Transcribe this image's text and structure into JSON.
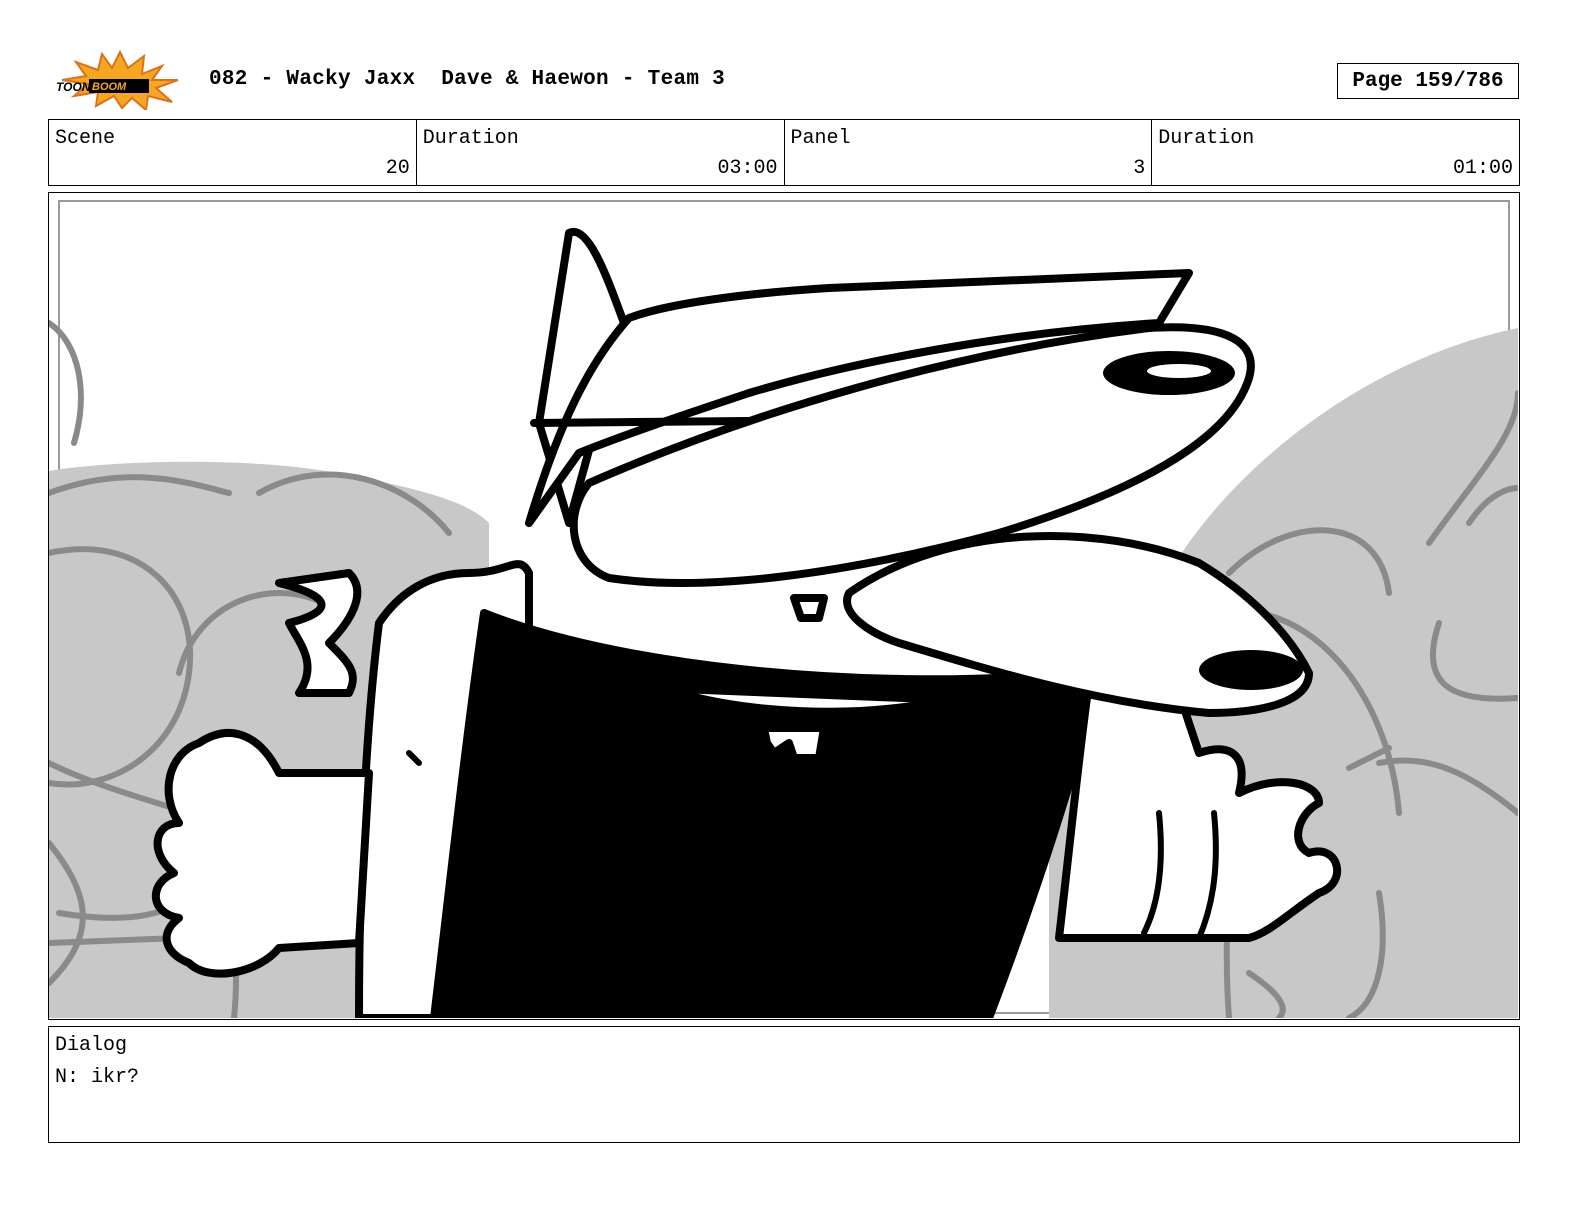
{
  "header": {
    "logo_text": "TOONBOOM",
    "title": "082 - Wacky Jaxx  Dave & Haewon - Team 3",
    "page": "Page 159/786"
  },
  "info": {
    "scene_label": "Scene",
    "scene_value": "20",
    "scene_duration_label": "Duration",
    "scene_duration_value": "03:00",
    "panel_label": "Panel",
    "panel_value": "3",
    "panel_duration_label": "Duration",
    "panel_duration_value": "01:00"
  },
  "dialog": {
    "label": "Dialog",
    "text": "N: ikr?"
  },
  "colors": {
    "logo_orange": "#f5a623",
    "background_gray": "#c8c8c8",
    "background_line": "#8a8a8a"
  }
}
